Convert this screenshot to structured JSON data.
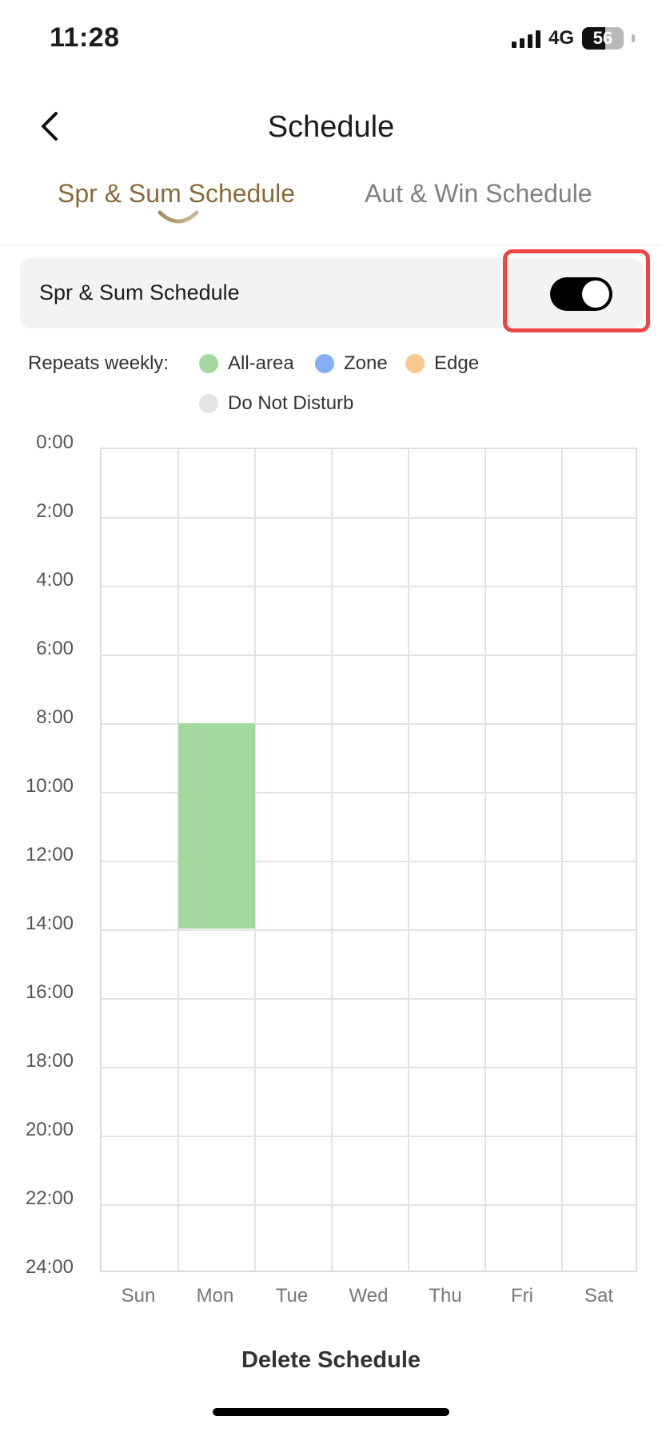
{
  "status_bar": {
    "time": "11:28",
    "network": "4G",
    "battery": "56"
  },
  "header": {
    "title": "Schedule",
    "back_icon": "chevron-left-icon"
  },
  "tabs": [
    {
      "label": "Spr & Sum Schedule",
      "active": true
    },
    {
      "label": "Aut & Win Schedule",
      "active": false
    }
  ],
  "toggle": {
    "label": "Spr & Sum Schedule",
    "on": true
  },
  "legend": {
    "label": "Repeats weekly:",
    "items": [
      {
        "label": "All-area",
        "color": "#a3d89e"
      },
      {
        "label": "Zone",
        "color": "#86aef6"
      },
      {
        "label": "Edge",
        "color": "#f7c98f"
      },
      {
        "label": "Do Not Disturb",
        "color": "#e4e4e4"
      }
    ]
  },
  "schedule": {
    "days": [
      "Sun",
      "Mon",
      "Tue",
      "Wed",
      "Thu",
      "Fri",
      "Sat"
    ],
    "times": [
      "0:00",
      "2:00",
      "4:00",
      "6:00",
      "8:00",
      "10:00",
      "12:00",
      "14:00",
      "16:00",
      "18:00",
      "20:00",
      "22:00",
      "24:00"
    ],
    "blocks": [
      {
        "day": "Mon",
        "start": 8,
        "end": 14,
        "type": "All-area"
      }
    ]
  },
  "delete_label": "Delete Schedule"
}
